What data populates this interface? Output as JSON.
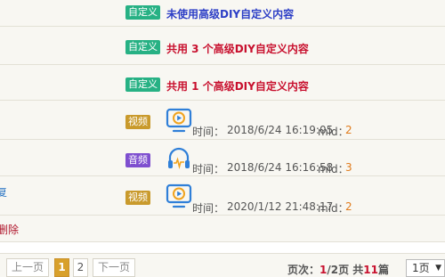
{
  "rows": [
    {
      "tag": "自定义",
      "text": "未使用高级DIY自定义内容"
    },
    {
      "tag": "自定义",
      "text": "共用 3 个高级DIY自定义内容"
    },
    {
      "tag": "自定义",
      "text": "共用 1 个高级DIY自定义内容"
    }
  ],
  "media": [
    {
      "tag": "视频",
      "icon": "video-monitor-icon",
      "time_label": "时间：",
      "time": "2018/6/24 16:19:05",
      "mid_label": "mid：",
      "mid": "2"
    },
    {
      "tag": "音频",
      "icon": "headphones-icon",
      "time_label": "时间：",
      "time": "2018/6/24 16:16:58",
      "mid_label": "mid：",
      "mid": "3"
    },
    {
      "tag": "视频",
      "icon": "video-monitor-icon",
      "time_label": "时间：",
      "time": "2020/1/12 21:48:17",
      "mid_label": "mid：",
      "mid": "2"
    }
  ],
  "edge": {
    "left_partial_text": "复",
    "delete_partial_text": "删除"
  },
  "pagination": {
    "prev": "上一页",
    "page1": "1",
    "page2": "2",
    "next": "下一页",
    "info_prefix": "页次：",
    "current": "1",
    "info_mid": "/2页 共",
    "total": "11",
    "info_suffix": "篇",
    "select_value": "1页"
  },
  "colors": {
    "custom_tag": "#27b184",
    "video_tag": "#c99a2c",
    "audio_tag": "#7e4fcf",
    "icon_blue": "#2f7fd8",
    "highlight_red": "#c8102e",
    "number_orange": "#e07b1c"
  }
}
